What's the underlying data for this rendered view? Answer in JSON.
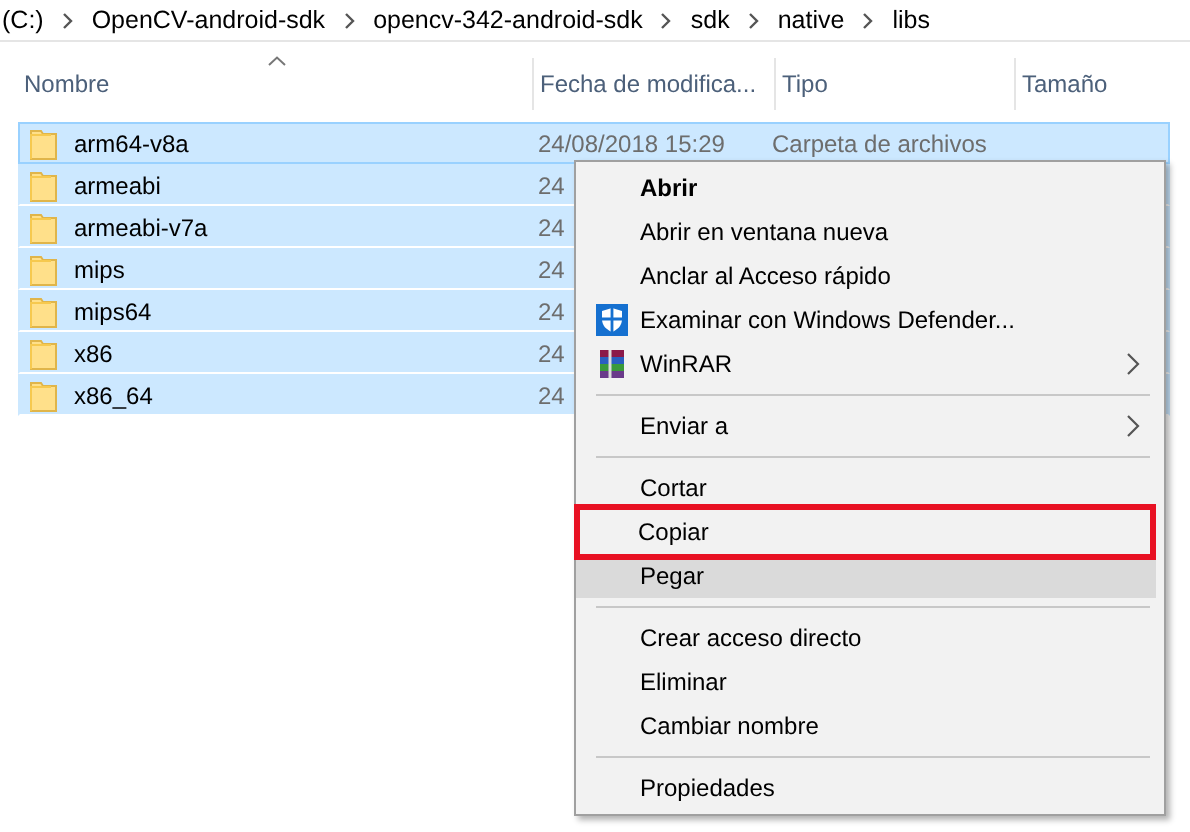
{
  "breadcrumb": [
    "(C:)",
    "OpenCV-android-sdk",
    "opencv-342-android-sdk",
    "sdk",
    "native",
    "libs"
  ],
  "columns": [
    {
      "label": "Nombre",
      "sorted": true
    },
    {
      "label": "Fecha de modifica...",
      "sorted": false
    },
    {
      "label": "Tipo",
      "sorted": false
    },
    {
      "label": "Tamaño",
      "sorted": false
    }
  ],
  "rows": [
    {
      "name": "arm64-v8a",
      "date": "24/08/2018 15:29",
      "type": "Carpeta de archivos",
      "selected": true,
      "focused": true
    },
    {
      "name": "armeabi",
      "date": "24",
      "selected": true,
      "focused": false
    },
    {
      "name": "armeabi-v7a",
      "date": "24",
      "selected": true,
      "focused": false
    },
    {
      "name": "mips",
      "date": "24",
      "selected": true,
      "focused": false
    },
    {
      "name": "mips64",
      "date": "24",
      "selected": true,
      "focused": false
    },
    {
      "name": "x86",
      "date": "24",
      "selected": true,
      "focused": false
    },
    {
      "name": "x86_64",
      "date": "24",
      "selected": true,
      "focused": false
    }
  ],
  "context_menu": [
    {
      "kind": "item",
      "label": "Abrir",
      "default": true
    },
    {
      "kind": "item",
      "label": "Abrir en ventana nueva"
    },
    {
      "kind": "item",
      "label": "Anclar al Acceso rápido"
    },
    {
      "kind": "shield",
      "label": "Examinar con Windows Defender..."
    },
    {
      "kind": "archive",
      "label": "WinRAR",
      "submenu": true
    },
    {
      "kind": "separator"
    },
    {
      "kind": "item",
      "label": "Enviar a",
      "submenu": true
    },
    {
      "kind": "separator"
    },
    {
      "kind": "item",
      "label": "Cortar"
    },
    {
      "kind": "item",
      "label": "Copiar",
      "marked": true
    },
    {
      "kind": "item",
      "label": "Pegar",
      "hovered": true
    },
    {
      "kind": "separator"
    },
    {
      "kind": "item",
      "label": "Crear acceso directo"
    },
    {
      "kind": "item",
      "label": "Eliminar"
    },
    {
      "kind": "item",
      "label": "Cambiar nombre"
    },
    {
      "kind": "separator"
    },
    {
      "kind": "item",
      "label": "Propiedades"
    }
  ]
}
